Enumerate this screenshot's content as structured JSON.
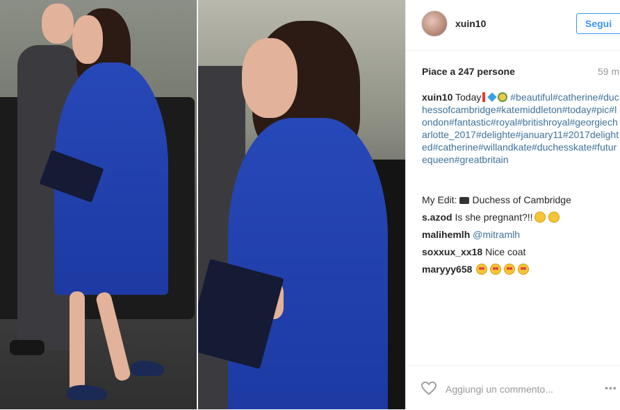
{
  "post": {
    "username": "xuin10",
    "follow_label": "Segui",
    "likes_text": "Piace a 247 persone",
    "time_text": "59 m"
  },
  "caption": {
    "author": "xuin10",
    "text": "Today",
    "hashtags": "#beautiful#catherine#duchessofcambridge#katemiddleton#today#pic#london#fantastic#royal#britishroyal#georgiecharlotte_2017#delighte#january11#2017delighted#catherine#willandkate#duchesskate#futurequeen#greatbritain"
  },
  "comments": [
    {
      "author": "",
      "prefix": "My Edit:",
      "text": "Duchess of Cambridge",
      "icon": "camera-icon"
    },
    {
      "author": "s.azod",
      "text": "Is she pregnant?!!",
      "icon": "thinking-face-icon"
    },
    {
      "author": "malihemlh",
      "text": "@mitramlh"
    },
    {
      "author": "soxxux_xx18",
      "text": "Nice coat"
    },
    {
      "author": "maryyy658",
      "text": "",
      "icon": "heart-eyes-icon"
    }
  ],
  "footer": {
    "add_comment_placeholder": "Aggiungi un commento...",
    "more_label": "•••"
  },
  "colors": {
    "link_blue": "#3897f0",
    "hashtag_blue": "#3f729b",
    "coat_blue": "#2446b3"
  }
}
